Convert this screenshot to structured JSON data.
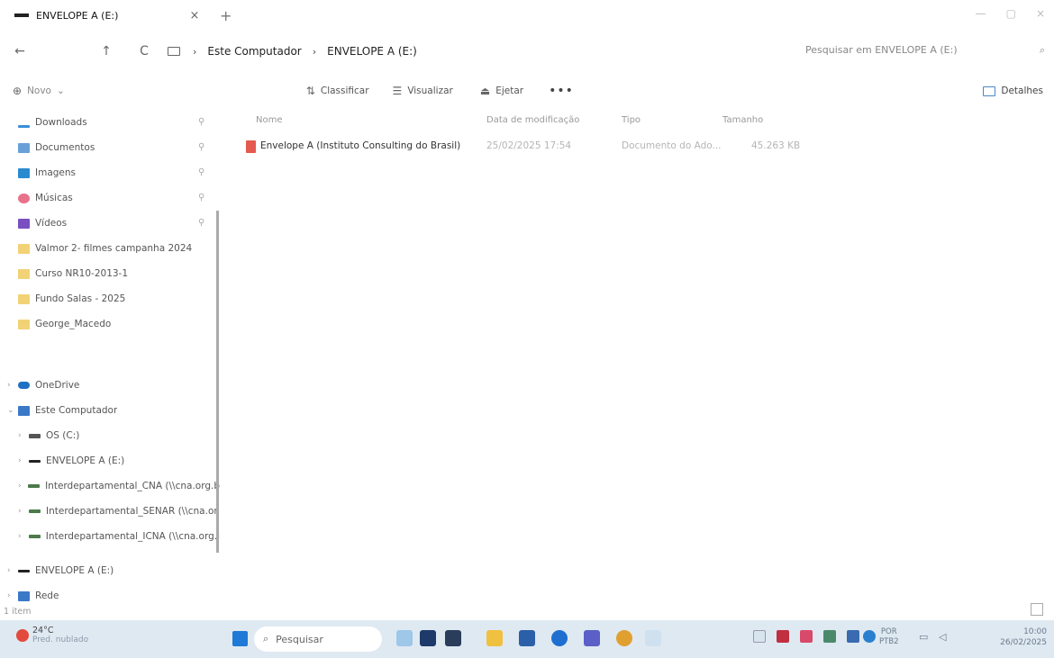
{
  "window": {
    "tab_title": "ENVELOPE A (E:)",
    "tab_close": "×",
    "new_tab": "+",
    "controls": [
      "—",
      "▢",
      "×"
    ]
  },
  "navigation": {
    "back": "←",
    "up": "↑",
    "refresh": "C",
    "breadcrumb": [
      "Este Computador",
      "ENVELOPE A (E:)"
    ],
    "separator": "›",
    "search_placeholder": "Pesquisar em ENVELOPE A (E:)",
    "search_icon": "⌕"
  },
  "commands": {
    "new": "Novo",
    "new_chevron": "⌄",
    "sort": "Classificar",
    "view": "Visualizar",
    "eject": "Ejetar",
    "more": "•••",
    "details": "Detalhes"
  },
  "sidebar": {
    "quick_access": [
      {
        "label": "Downloads",
        "icon": "download-icon",
        "color": "#3a8ed8"
      },
      {
        "label": "Documentos",
        "icon": "documents-icon",
        "color": "#6aa0d8"
      },
      {
        "label": "Imagens",
        "icon": "images-icon",
        "color": "#2a8ad0"
      },
      {
        "label": "Músicas",
        "icon": "music-icon",
        "color": "#e7728a"
      },
      {
        "label": "Vídeos",
        "icon": "videos-icon",
        "color": "#7a4fc0"
      },
      {
        "label": "Valmor 2- filmes campanha 2024",
        "icon": "folder-icon"
      },
      {
        "label": "Curso NR10-2013-1",
        "icon": "folder-icon"
      },
      {
        "label": "Fundo Salas - 2025",
        "icon": "folder-icon"
      },
      {
        "label": "George_Macedo",
        "icon": "folder-icon"
      }
    ],
    "onedrive": "OneDrive",
    "this_pc": "Este Computador",
    "drives": [
      "OS (C:)",
      "ENVELOPE A (E:)",
      "Interdepartamental_CNA (\\\\cna.org.b",
      "Interdepartamental_SENAR (\\\\cna.or",
      "Interdepartamental_ICNA (\\\\cna.org.i"
    ],
    "envelope": "ENVELOPE A (E:)",
    "network": "Rede"
  },
  "file_list": {
    "columns": [
      "Nome",
      "Data de modificação",
      "Tipo",
      "Tamanho"
    ],
    "rows": [
      {
        "name": "Envelope A (Instituto Consulting do Brasil)",
        "modified": "25/02/2025 17:54",
        "type": "Documento do Ado...",
        "size": "45.263 KB"
      }
    ]
  },
  "status": {
    "item_count": "1 item"
  },
  "taskbar": {
    "weather_temp": "24°C",
    "weather_desc": "Pred. nublado",
    "search_label": "Pesquisar",
    "lang_top": "POR",
    "lang_bottom": "PTB2",
    "time": "10:00",
    "date": "26/02/2025"
  }
}
